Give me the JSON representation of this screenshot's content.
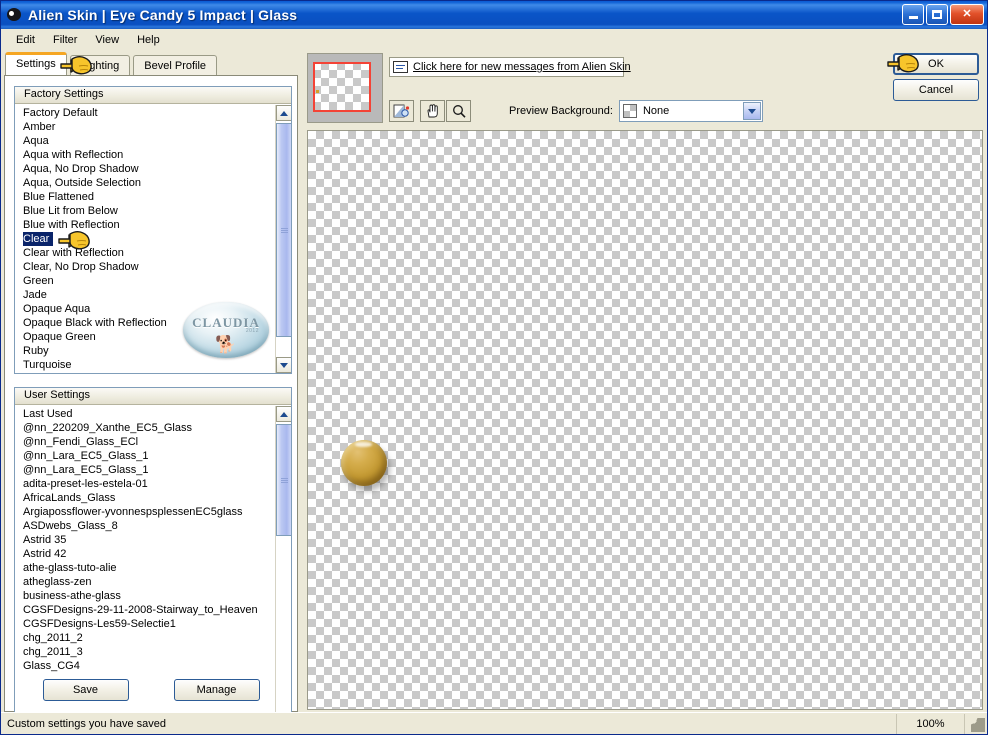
{
  "window": {
    "title": "Alien Skin  |  Eye Candy 5 Impact  |  Glass",
    "logo_icon": "alien-head-icon",
    "minimize_icon": "minimize-icon",
    "maximize_icon": "maximize-icon",
    "close_icon": "close-icon",
    "accent_color": "#0a55c8",
    "face_color": "#ece9d8"
  },
  "menubar": {
    "items": [
      {
        "label": "Edit"
      },
      {
        "label": "Filter"
      },
      {
        "label": "View"
      },
      {
        "label": "Help"
      }
    ]
  },
  "tabs": [
    {
      "label": "Settings",
      "active": true
    },
    {
      "label": "Lighting",
      "active": false
    },
    {
      "label": "Bevel Profile",
      "active": false
    }
  ],
  "factory_settings": {
    "header": "Factory Settings",
    "selected": "Clear",
    "items": [
      "Factory Default",
      "Amber",
      "Aqua",
      "Aqua with Reflection",
      "Aqua, No Drop Shadow",
      "Aqua, Outside Selection",
      "Blue Flattened",
      "Blue Lit from Below",
      "Blue with Reflection",
      "Clear",
      "Clear with Reflection",
      "Clear, No Drop Shadow",
      "Green",
      "Jade",
      "Opaque Aqua",
      "Opaque Black with Reflection",
      "Opaque Green",
      "Ruby",
      "Turquoise"
    ]
  },
  "user_settings": {
    "header": "User Settings",
    "items": [
      "Last Used",
      "@nn_220209_Xanthe_EC5_Glass",
      "@nn_Fendi_Glass_ECl",
      "@nn_Lara_EC5_Glass_1",
      "@nn_Lara_EC5_Glass_1",
      "adita-preset-les-estela-01",
      "AfricaLands_Glass",
      "Argiapossflower-yvonnespsplessenEC5glass",
      "ASDwebs_Glass_8",
      "Astrid 35",
      "Astrid 42",
      "athe-glass-tuto-alie",
      "atheglass-zen",
      "business-athe-glass",
      "CGSFDesigns-29-11-2008-Stairway_to_Heaven",
      "CGSFDesigns-Les59-Selectie1",
      "chg_2011_2",
      "chg_2011_3",
      "Glass_CG4"
    ]
  },
  "settings_buttons": {
    "save": "Save",
    "manage": "Manage"
  },
  "watermark": {
    "text": "CLAUDIA",
    "subtext": "2012",
    "icon": "dog-icon"
  },
  "preview_panel": {
    "thumbnail_icon": "thumbnail-preview",
    "message_link": "Click here for new messages from Alien Skin",
    "message_icon": "envelope-message-icon",
    "tools": [
      {
        "name": "before-after-icon",
        "title": "Preview toggle"
      },
      {
        "name": "hand-pan-icon",
        "title": "Pan"
      },
      {
        "name": "magnifier-zoom-icon",
        "title": "Zoom"
      }
    ],
    "preview_background_label": "Preview Background:",
    "preview_background_value": "None",
    "dropdown_icon": "chevron-down-icon"
  },
  "actions": {
    "ok": "OK",
    "cancel": "Cancel"
  },
  "statusbar": {
    "message": "Custom settings you have saved",
    "zoom": "100%",
    "grip_icon": "resize-grip-icon"
  },
  "annotations": {
    "hand_tab": "pointing-hand-settings-tab",
    "hand_clear": "pointing-hand-clear-item",
    "hand_ok": "pointing-hand-ok-button"
  }
}
